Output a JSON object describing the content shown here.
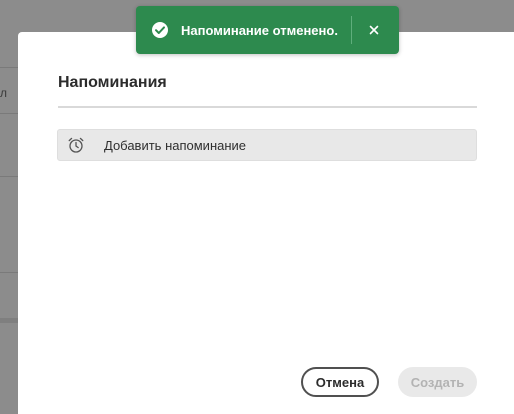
{
  "toast": {
    "message": "Напоминание отменено.",
    "status_icon": "check-circle-icon",
    "close_icon": "close-icon",
    "color": "#2d8a4e"
  },
  "dialog": {
    "title": "Напоминания",
    "add_reminder": {
      "label": "Добавить напоминание",
      "icon": "alarm-clock-icon"
    },
    "buttons": {
      "cancel_label": "Отмена",
      "create_label": "Создать"
    }
  }
}
